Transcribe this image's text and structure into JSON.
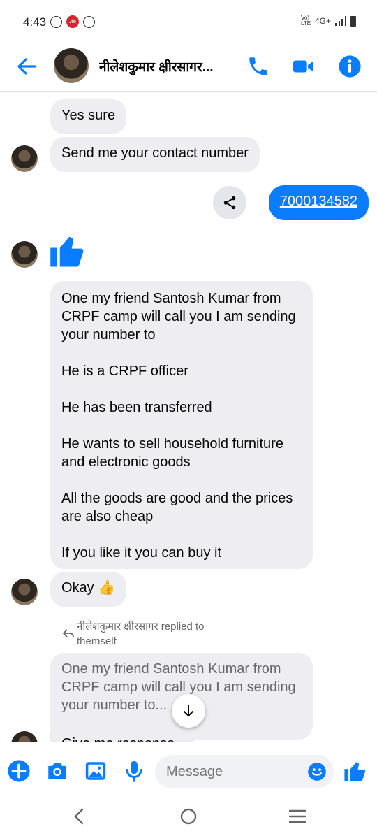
{
  "status": {
    "time": "4:43",
    "network": "4G+",
    "volte": "VoLTE"
  },
  "header": {
    "contact_name": "नीलेशकुमार क्षीरसागर..."
  },
  "messages": {
    "m1": "Yes sure",
    "m2": "Send me your contact number",
    "out_number": "7000134582",
    "long": {
      "p1": "One my friend Santosh Kumar from CRPF camp will call you I am sending your number to",
      "p2": "He is a CRPF officer",
      "p3": "He has been transferred",
      "p4": "He wants to sell household furniture and electronic goods",
      "p5": "All the goods are good and the prices are also cheap",
      "p6": "If you like it you can buy it"
    },
    "okay": "Okay 👍",
    "reply_note": "नीलेशकुमार क्षीरसागर replied to themself",
    "quoted": "One my friend Santosh Kumar from CRPF camp will call you I am sending your number to...",
    "last": "Give me response"
  },
  "composer": {
    "placeholder": "Message"
  },
  "colors": {
    "accent": "#0a7cff",
    "bubble_in": "#eeeef2"
  }
}
